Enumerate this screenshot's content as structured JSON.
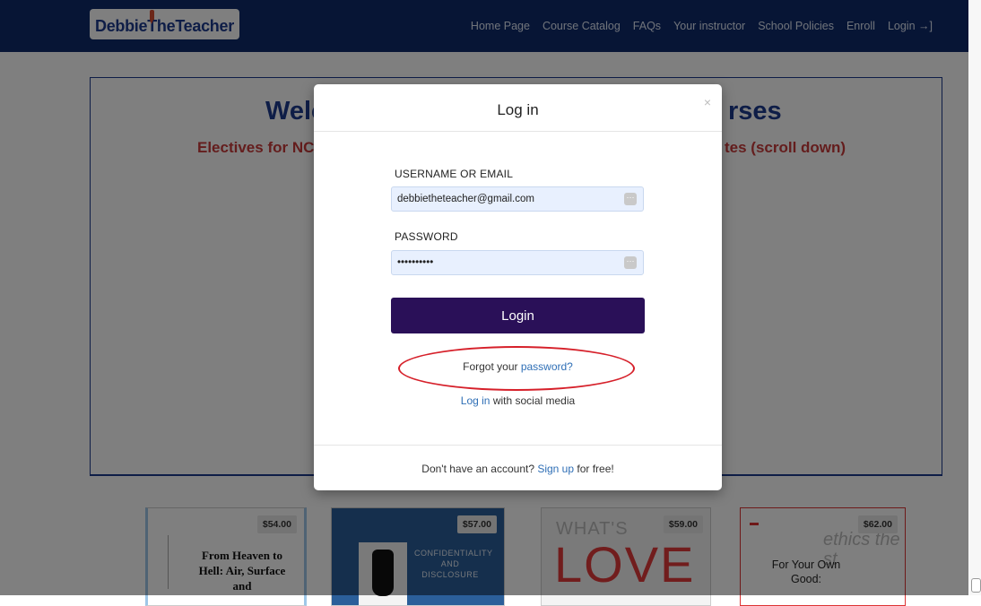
{
  "nav": {
    "logo": "DebbieTheTeacher",
    "links": [
      "Home Page",
      "Course Catalog",
      "FAQs",
      "Your instructor",
      "School Policies",
      "Enroll"
    ],
    "login": "Login",
    "login_icon": "login-arrow-icon"
  },
  "page": {
    "hero_title_left": "Welc",
    "hero_title_right": "rses",
    "hero_sub_left": "Electives for NC",
    "hero_sub_right": "tes (scroll down)"
  },
  "courses": [
    {
      "price": "$54.00",
      "cover_text": "From Heaven to Hell: Air, Surface and"
    },
    {
      "price": "$57.00",
      "cover_text": "CONFIDENTIALITY AND DISCLOSURE"
    },
    {
      "price": "$59.00",
      "cover_text_top": "WHAT'S",
      "cover_text_main": "LOVE"
    },
    {
      "price": "$62.00",
      "cover_text": "For Your Own Good:",
      "cover_bg_text": "ethics the st"
    }
  ],
  "modal": {
    "title": "Log in",
    "close": "×",
    "username_label": "USERNAME OR EMAIL",
    "username_value": "debbietheteacher@gmail.com",
    "password_label": "PASSWORD",
    "password_value": "••••••••••",
    "login_button": "Login",
    "forgot_prefix": "Forgot your ",
    "forgot_link": "password?",
    "social_link": "Log in",
    "social_suffix": " with social media",
    "footer_prefix": "Don't have an account? ",
    "footer_link": "Sign up",
    "footer_suffix": " for free!"
  },
  "colors": {
    "nav_bg": "#0f2b6a",
    "login_button": "#2a1058",
    "link": "#2f6fb6",
    "highlight_ellipse": "#d6202a"
  }
}
